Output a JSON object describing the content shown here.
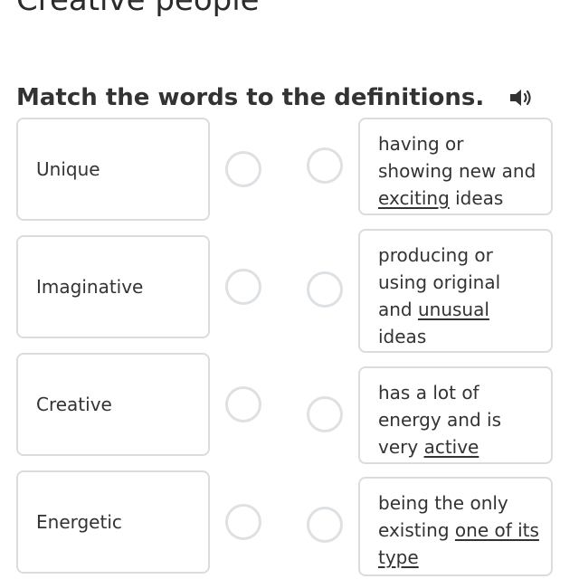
{
  "page": {
    "title": "Creative people"
  },
  "exercise": {
    "instruction": "Match the words to the definitions.",
    "audio_icon": "speaker-icon"
  },
  "words": [
    {
      "label": "Unique"
    },
    {
      "label": "Imaginative"
    },
    {
      "label": "Creative"
    },
    {
      "label": "Energetic"
    }
  ],
  "definitions": [
    {
      "segments": [
        {
          "text": "having or showing new and ",
          "underline": false
        },
        {
          "text": "exciting",
          "underline": true
        },
        {
          "text": " ideas",
          "underline": false
        }
      ]
    },
    {
      "segments": [
        {
          "text": "producing or using original and ",
          "underline": false
        },
        {
          "text": "unusual",
          "underline": true
        },
        {
          "text": " ideas",
          "underline": false
        }
      ]
    },
    {
      "segments": [
        {
          "text": "has a lot of energy and is very ",
          "underline": false
        },
        {
          "text": "active",
          "underline": true
        }
      ]
    },
    {
      "segments": [
        {
          "text": "being the only existing ",
          "underline": false
        },
        {
          "text": "one of its type",
          "underline": true
        }
      ]
    }
  ],
  "colors": {
    "card_border": "#dcdcdc",
    "circle_border": "#dde1e4",
    "text": "#333333"
  }
}
